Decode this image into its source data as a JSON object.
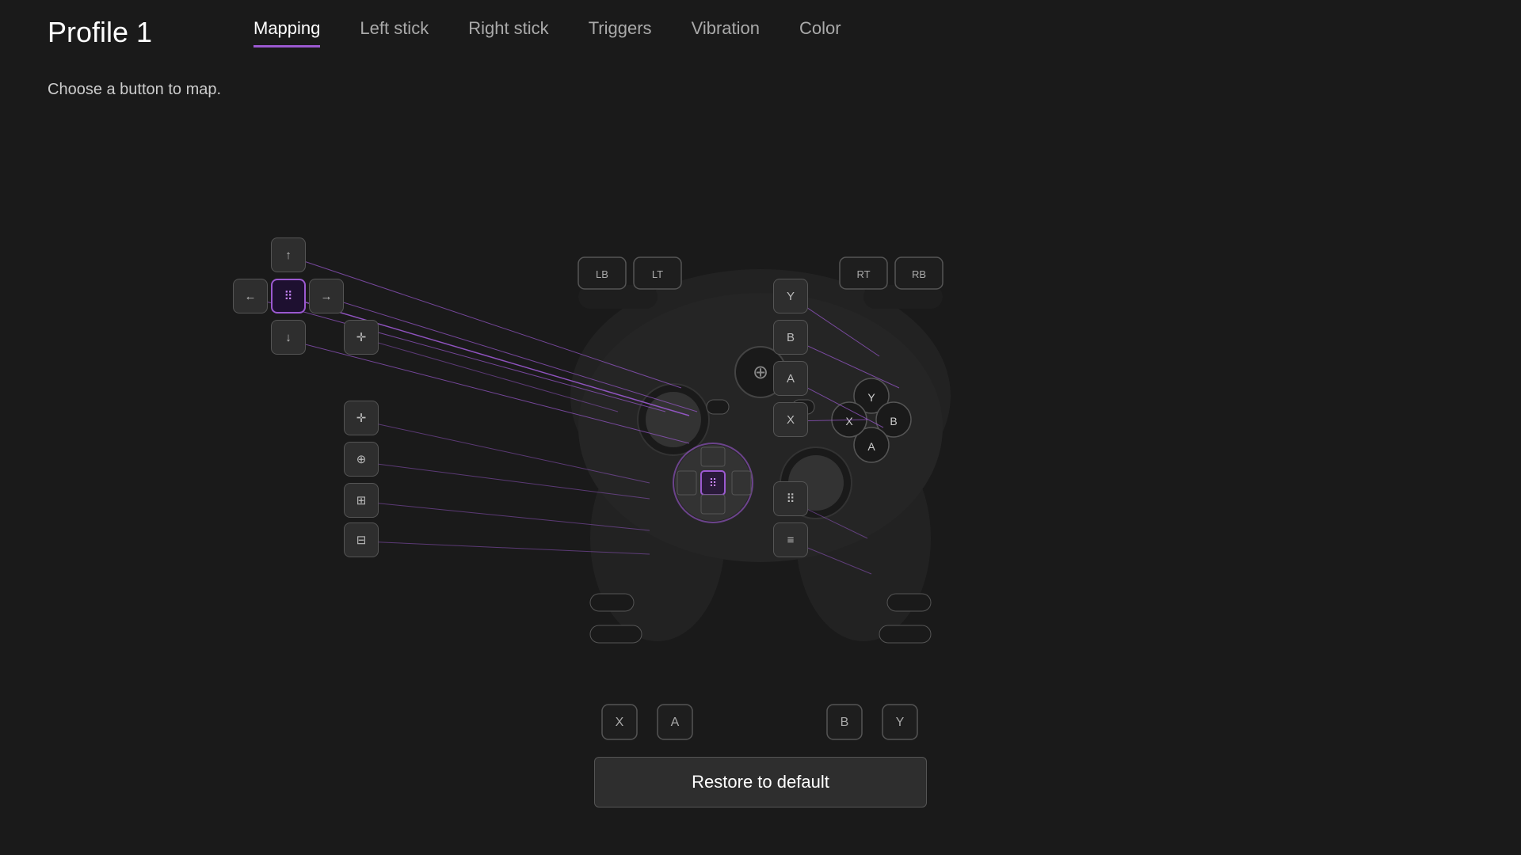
{
  "header": {
    "profile_title": "Profile 1",
    "tabs": [
      {
        "id": "mapping",
        "label": "Mapping",
        "active": true
      },
      {
        "id": "left_stick",
        "label": "Left stick",
        "active": false
      },
      {
        "id": "right_stick",
        "label": "Right stick",
        "active": false
      },
      {
        "id": "triggers",
        "label": "Triggers",
        "active": false
      },
      {
        "id": "vibration",
        "label": "Vibration",
        "active": false
      },
      {
        "id": "color",
        "label": "Color",
        "active": false
      }
    ]
  },
  "subtitle": "Choose a button to map.",
  "restore_button": "Restore to default",
  "colors": {
    "active_tab_underline": "#9b59d0",
    "selected_btn_border": "#9b59d0",
    "selected_btn_bg": "#1e1030",
    "bg": "#1a1a1a",
    "btn_bg": "#2e2e2e",
    "btn_border": "#555555"
  },
  "left_side_buttons": [
    {
      "id": "up",
      "icon": "↑",
      "selected": false
    },
    {
      "id": "left",
      "icon": "←",
      "selected": false
    },
    {
      "id": "center",
      "icon": "⠿",
      "selected": true
    },
    {
      "id": "right",
      "icon": "→",
      "selected": false
    },
    {
      "id": "down",
      "icon": "↓",
      "selected": false
    },
    {
      "id": "dpad_full",
      "icon": "✛",
      "selected": false
    },
    {
      "id": "dpad_alt",
      "icon": "⊕",
      "selected": false
    },
    {
      "id": "dpad_3",
      "icon": "⊞",
      "selected": false
    },
    {
      "id": "dpad_4",
      "icon": "⊟",
      "selected": false
    }
  ],
  "right_side_buttons": [
    {
      "id": "y_btn",
      "label": "Y",
      "selected": false
    },
    {
      "id": "b_btn",
      "label": "B",
      "selected": false
    },
    {
      "id": "a_btn",
      "label": "A",
      "selected": false
    },
    {
      "id": "x_btn",
      "label": "X",
      "selected": false
    },
    {
      "id": "paddle_r1",
      "icon": "⠿",
      "selected": false
    },
    {
      "id": "paddle_r2",
      "icon": "≡",
      "selected": false
    }
  ],
  "top_buttons": [
    {
      "id": "lb",
      "label": "LB",
      "selected": false
    },
    {
      "id": "lt",
      "label": "LT",
      "selected": false
    },
    {
      "id": "rt",
      "label": "RT",
      "selected": false
    },
    {
      "id": "rb",
      "label": "RB",
      "selected": false
    }
  ],
  "bottom_buttons": [
    {
      "id": "x_bot",
      "label": "X",
      "selected": false
    },
    {
      "id": "a_bot",
      "label": "A",
      "selected": false
    },
    {
      "id": "b_bot",
      "label": "B",
      "selected": false
    },
    {
      "id": "y_bot",
      "label": "Y",
      "selected": false
    }
  ]
}
